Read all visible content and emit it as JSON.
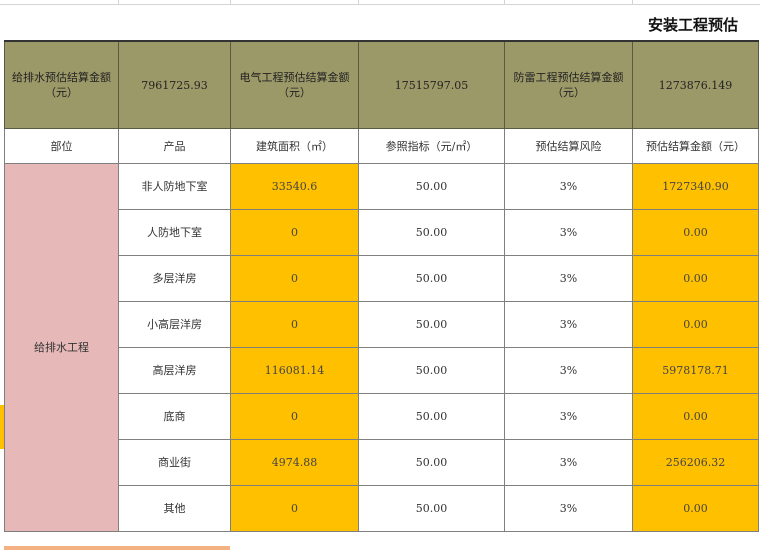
{
  "title": "安装工程预估",
  "header": [
    {
      "label": "给排水预估结算金额（元）",
      "value": "7961725.93"
    },
    {
      "label": "电气工程预估结算金额（元）",
      "value": "17515797.05"
    },
    {
      "label": "防雷工程预估结算金额（元）",
      "value": "1273876.149"
    }
  ],
  "columns": [
    "部位",
    "产品",
    "建筑面积（㎡）",
    "参照指标（元/㎡）",
    "预估结算风险",
    "预估结算金额（元）"
  ],
  "category": "给排水工程",
  "rows": [
    {
      "product": "非人防地下室",
      "area": "33540.6",
      "index": "50.00",
      "risk": "3%",
      "amount": "1727340.90"
    },
    {
      "product": "人防地下室",
      "area": "0",
      "index": "50.00",
      "risk": "3%",
      "amount": "0.00"
    },
    {
      "product": "多层洋房",
      "area": "0",
      "index": "50.00",
      "risk": "3%",
      "amount": "0.00"
    },
    {
      "product": "小高层洋房",
      "area": "0",
      "index": "50.00",
      "risk": "3%",
      "amount": "0.00"
    },
    {
      "product": "高层洋房",
      "area": "116081.14",
      "index": "50.00",
      "risk": "3%",
      "amount": "5978178.71"
    },
    {
      "product": "底商",
      "area": "0",
      "index": "50.00",
      "risk": "3%",
      "amount": "0.00"
    },
    {
      "product": "商业街",
      "area": "4974.88",
      "index": "50.00",
      "risk": "3%",
      "amount": "256206.32"
    },
    {
      "product": "其他",
      "area": "0",
      "index": "50.00",
      "risk": "3%",
      "amount": "0.00"
    }
  ],
  "colors": {
    "header": "#9c9968",
    "highlight": "#ffc000",
    "category": "#e6b9b8"
  }
}
